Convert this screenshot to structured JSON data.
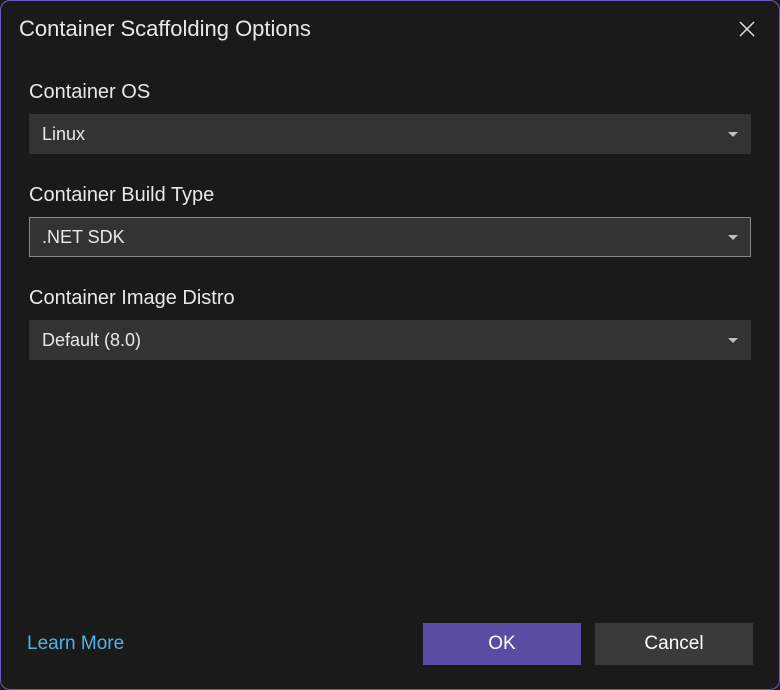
{
  "dialog": {
    "title": "Container Scaffolding Options"
  },
  "fields": {
    "os": {
      "label": "Container OS",
      "value": "Linux"
    },
    "buildType": {
      "label": "Container Build Type",
      "value": ".NET SDK"
    },
    "imageDistro": {
      "label": "Container Image Distro",
      "value": "Default (8.0)"
    }
  },
  "footer": {
    "learnMore": "Learn More",
    "ok": "OK",
    "cancel": "Cancel"
  }
}
